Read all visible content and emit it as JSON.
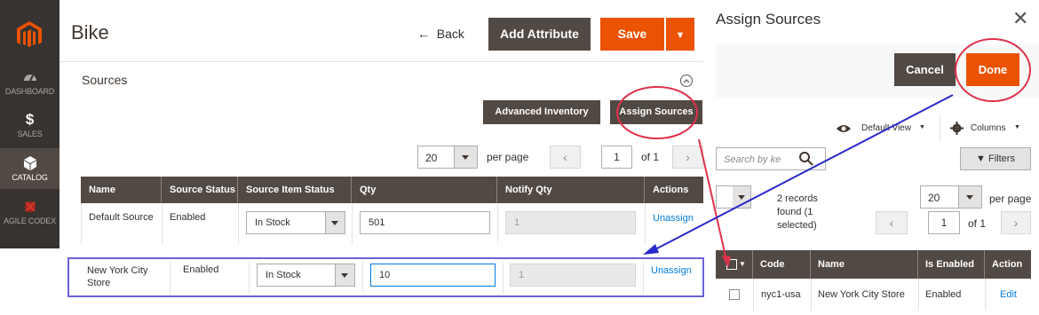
{
  "sidebar": {
    "items": [
      {
        "label": "DASHBOARD",
        "icon": "dashboard-icon"
      },
      {
        "label": "SALES",
        "icon": "dollar-icon"
      },
      {
        "label": "CATALOG",
        "icon": "box-icon"
      },
      {
        "label": "AGILE CODEX",
        "icon": "agile-codex-icon"
      }
    ]
  },
  "header": {
    "title": "Bike",
    "back_label": "Back",
    "add_attribute_label": "Add Attribute",
    "save_label": "Save"
  },
  "sources": {
    "title": "Sources",
    "advanced_inventory_label": "Advanced Inventory",
    "assign_sources_label": "Assign Sources",
    "pager": {
      "per_page": "20",
      "per_page_label": "per page",
      "page": "1",
      "of_label": "of 1"
    },
    "columns": [
      "Name",
      "Source Status",
      "Source Item Status",
      "Qty",
      "Notify Qty",
      "Actions"
    ],
    "rows": [
      {
        "name": "Default Source",
        "status": "Enabled",
        "item_status": "In Stock",
        "qty": "501",
        "notify_qty": "1",
        "action": "Unassign"
      },
      {
        "name": "New York City Store",
        "status": "Enabled",
        "item_status": "In Stock",
        "qty": "10",
        "notify_qty": "1",
        "action": "Unassign"
      }
    ]
  },
  "modal": {
    "title": "Assign Sources",
    "cancel_label": "Cancel",
    "done_label": "Done",
    "default_view_label": "Default View",
    "columns_label": "Columns",
    "search_placeholder": "Search by ke",
    "filters_label": "Filters",
    "records_line1": "2 records",
    "records_line2": "found (1",
    "records_line3": "selected)",
    "pager": {
      "per_page": "20",
      "per_page_label": "per page",
      "page": "1",
      "of_label": "of 1"
    },
    "columns": [
      "Code",
      "Name",
      "Is Enabled",
      "Action"
    ],
    "rows": [
      {
        "code": "nyc1-usa",
        "name": "New York City Store",
        "enabled": "Enabled",
        "action": "Edit"
      }
    ]
  },
  "colors": {
    "accent": "#eb5202",
    "dark": "#514943",
    "annotation_red": "#e0314b",
    "annotation_blue": "#2a29c9"
  }
}
